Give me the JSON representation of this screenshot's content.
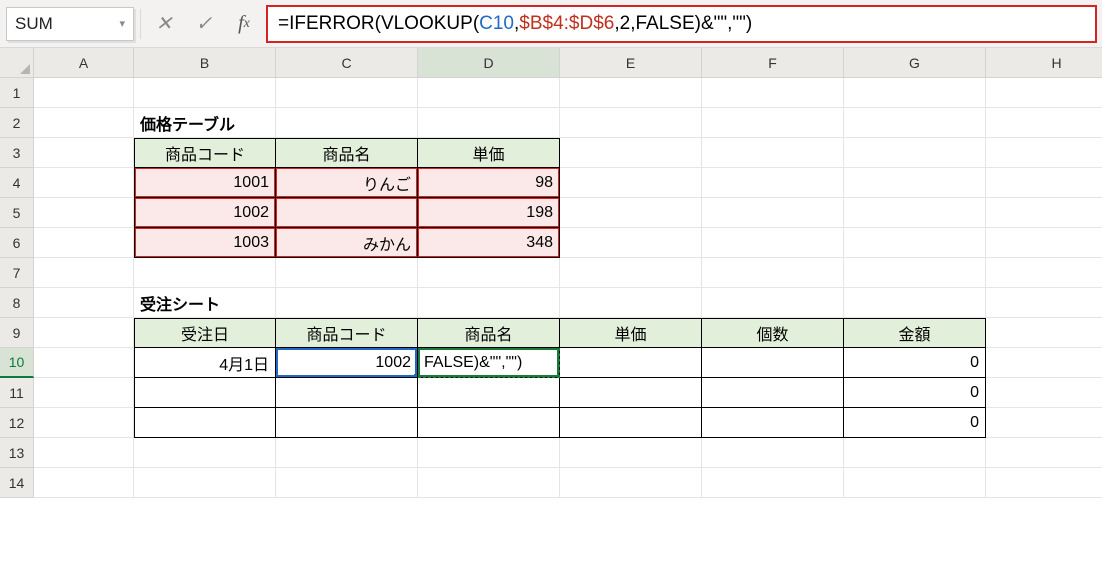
{
  "formula_bar": {
    "name_box": "SUM",
    "formula_parts": {
      "p1": "=IFERROR",
      "p2": "(",
      "p3": "VLOOKUP",
      "p4": "(",
      "p5": "C10",
      "p6": ",",
      "p7": "$B$4:$D$6",
      "p8": ",2,FALSE",
      "p9": ")",
      "p10": "&\"\",\"\"",
      "p11": ")"
    }
  },
  "columns": [
    "A",
    "B",
    "C",
    "D",
    "E",
    "F",
    "G",
    "H"
  ],
  "rows": [
    "1",
    "2",
    "3",
    "4",
    "5",
    "6",
    "7",
    "8",
    "9",
    "10",
    "11",
    "12",
    "13",
    "14"
  ],
  "table1": {
    "title": "価格テーブル",
    "headers": {
      "code": "商品コード",
      "name": "商品名",
      "price": "単価"
    },
    "rows": [
      {
        "code": "1001",
        "name": "りんご",
        "price": "98"
      },
      {
        "code": "1002",
        "name": "",
        "price": "198"
      },
      {
        "code": "1003",
        "name": "みかん",
        "price": "348"
      }
    ]
  },
  "table2": {
    "title": "受注シート",
    "headers": {
      "date": "受注日",
      "code": "商品コード",
      "name": "商品名",
      "price": "単価",
      "qty": "個数",
      "amount": "金額"
    },
    "rows": [
      {
        "date": "4月1日",
        "code": "1002",
        "name": "FALSE)&\"\",\"\")",
        "price": "",
        "qty": "",
        "amount": "0"
      },
      {
        "date": "",
        "code": "",
        "name": "",
        "price": "",
        "qty": "",
        "amount": "0"
      },
      {
        "date": "",
        "code": "",
        "name": "",
        "price": "",
        "qty": "",
        "amount": "0"
      }
    ]
  },
  "active_cell": "D10"
}
